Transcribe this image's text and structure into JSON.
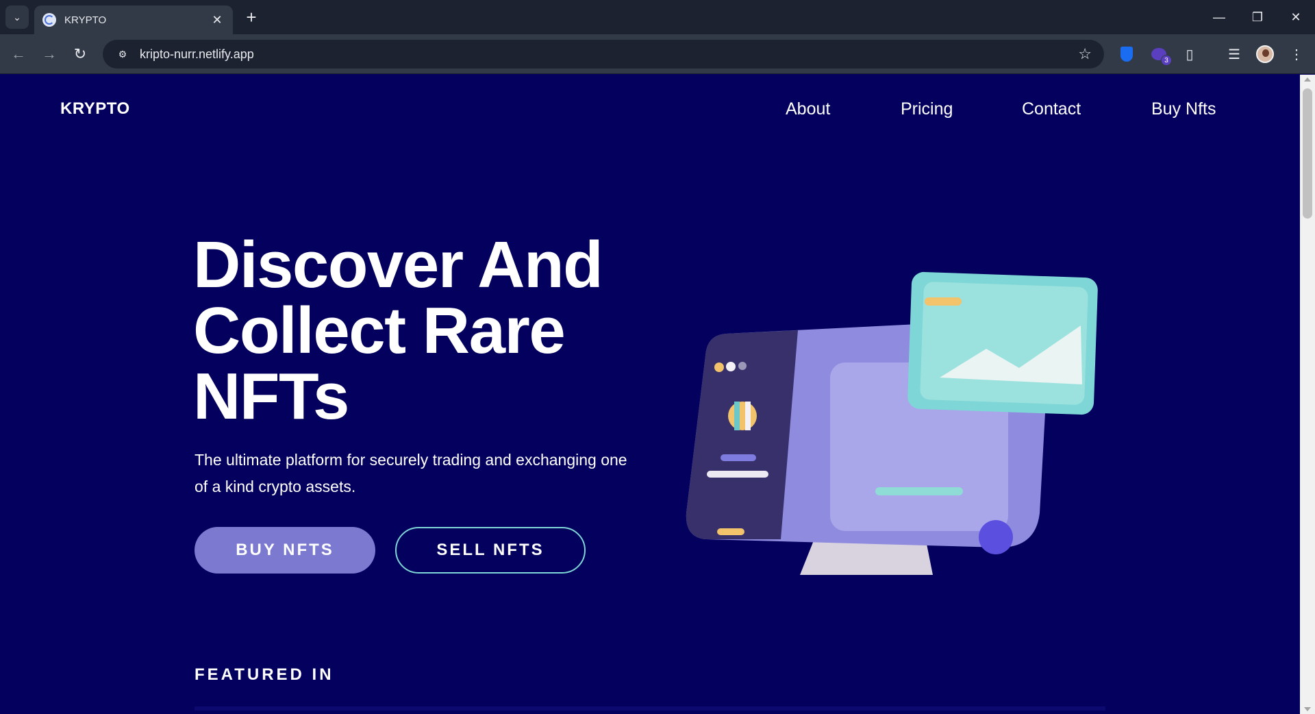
{
  "browser": {
    "tab_title": "KRYPTO",
    "url": "kripto-nurr.netlify.app",
    "extension_badge": "3"
  },
  "site": {
    "logo": "KRYPTO",
    "nav": [
      "About",
      "Pricing",
      "Contact",
      "Buy Nfts"
    ]
  },
  "hero": {
    "title_line1": "Discover And",
    "title_line2": "Collect Rare",
    "title_line3": "NFTs",
    "subtitle": "The ultimate platform for securely trading and exchanging one of a kind crypto assets.",
    "buy_label": "BUY NFTS",
    "sell_label": "SELL NFTS"
  },
  "featured": {
    "heading": "FEATURED IN"
  },
  "colors": {
    "background": "#04005e",
    "primary_button": "#7c79d0",
    "outline_button": "#7fd6d6"
  }
}
